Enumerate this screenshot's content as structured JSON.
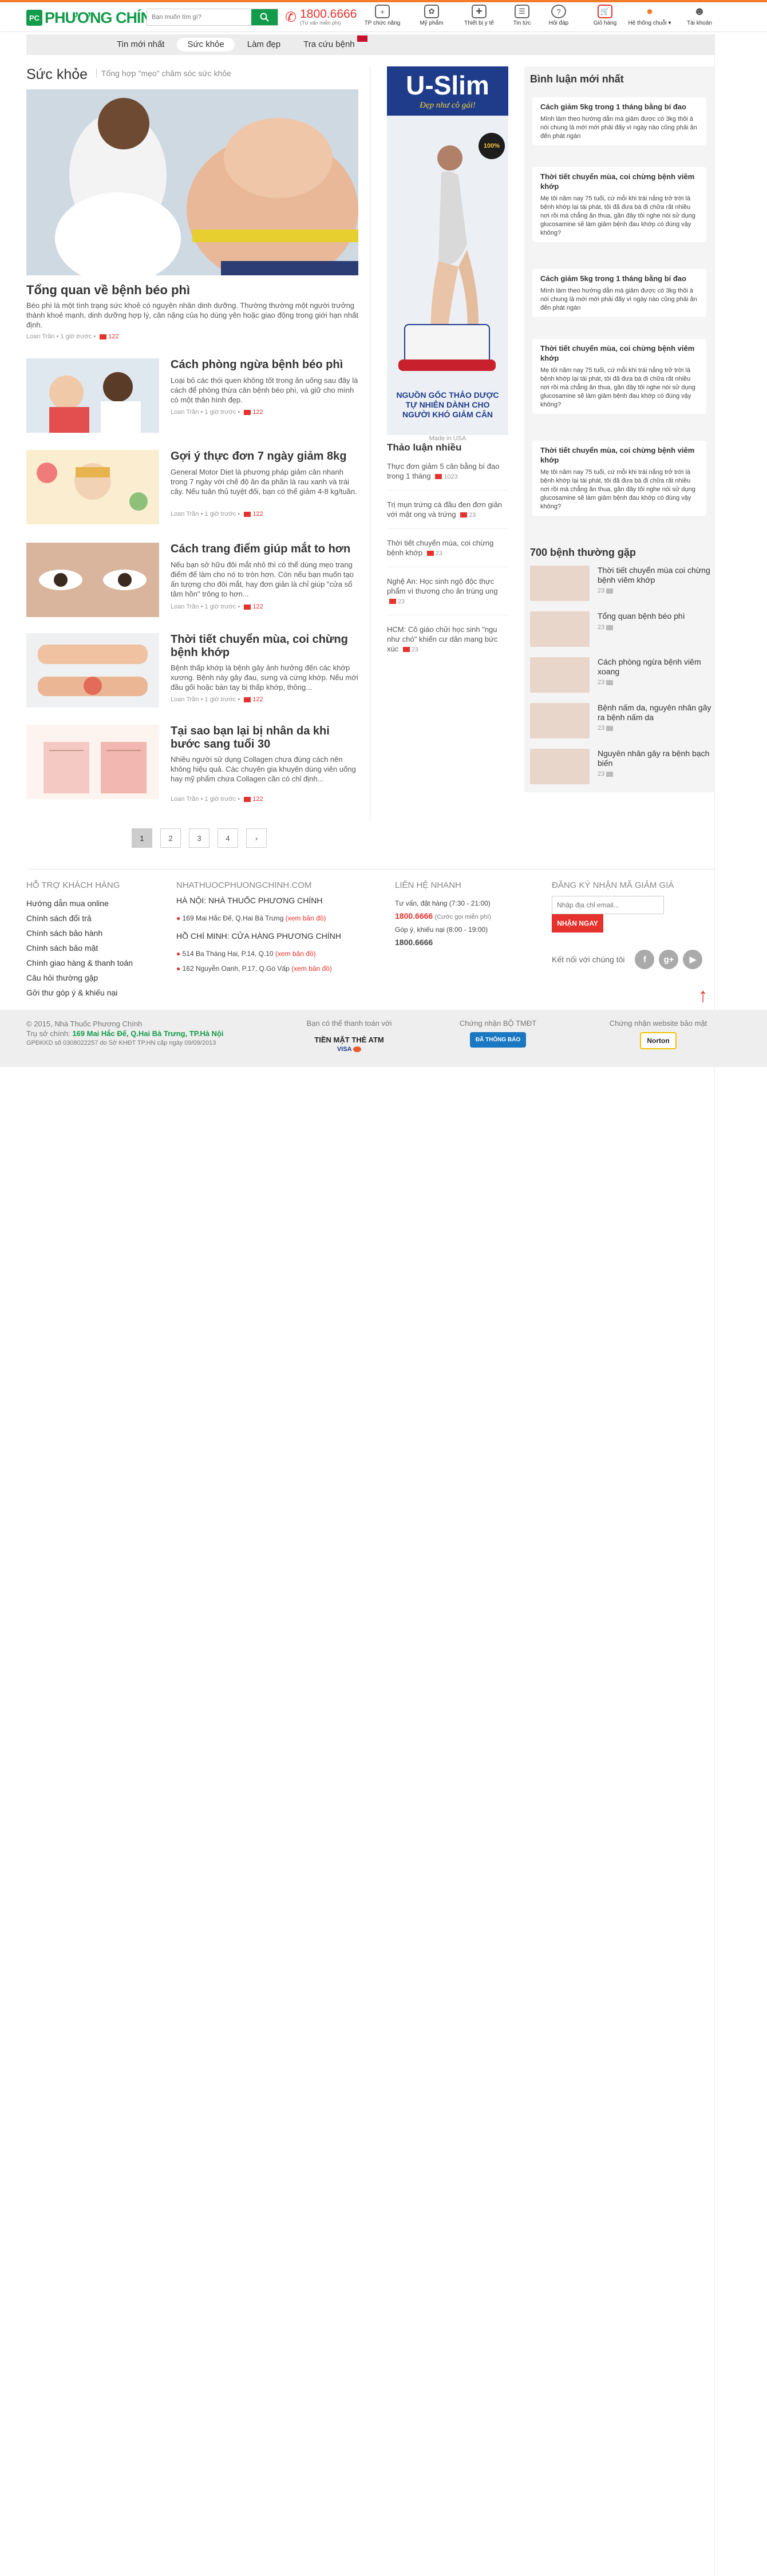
{
  "header": {
    "logo_mark": "PC",
    "logo_text": "PHƯƠNG CHÍNH",
    "search_placeholder": "Bạn muốn tìm gì?",
    "hotline_number": "1800.6666",
    "hotline_sub": "(Tư vấn miễn phí)",
    "nav": [
      {
        "label": "TP chức năng",
        "icon": "supplement-box-icon"
      },
      {
        "label": "Mỹ phẩm",
        "icon": "cosmetics-icon"
      },
      {
        "label": "Thiết bị y tế",
        "icon": "medical-kit-icon"
      },
      {
        "label": "Tin tức",
        "icon": "news-icon"
      },
      {
        "label": "Hỏi đáp",
        "icon": "question-icon"
      },
      {
        "label": "Giỏ hàng",
        "icon": "cart-icon"
      },
      {
        "label": "Hệ thống chuỗi",
        "icon": "location-pin-icon"
      },
      {
        "label": "Tài khoản",
        "icon": "user-icon"
      }
    ]
  },
  "menu": {
    "items": [
      "Tin mới nhất",
      "Sức khỏe",
      "Làm đẹp",
      "Tra cứu bệnh"
    ],
    "active_index": 1
  },
  "page": {
    "title": "Sức khỏe",
    "subtitle": "Tổng hợp \"mẹo\" chăm sóc sức khỏe"
  },
  "featured": {
    "title": "Tổng quan về bệnh béo phì",
    "desc": "Béo phì là một tình trạng sức khoẻ có nguyên nhân dinh dưỡng. Thường thường một người trưởng thành khoẻ mạnh, dinh dưỡng hợp lý, cân nặng của họ dùng yên hoặc giao động trong giới hạn nhất định.",
    "author": "Loan Trần",
    "time": "1 giờ trước",
    "comments": "122"
  },
  "articles": [
    {
      "title": "Cách phòng ngừa bệnh béo phì",
      "desc": "Loại bỏ các thói quen không tốt trong ăn uống sau đây là cách để phòng thừa cân bệnh béo phì, và giữ cho mình có một thân hình đẹp.",
      "author": "Loan Trần",
      "time": "1 giờ trước",
      "comments": "122"
    },
    {
      "title": "Gợi ý thực đơn 7 ngày giảm 8kg",
      "desc": "General Motor Diet là phương pháp giảm cân nhanh trong 7 ngày với chế độ ăn đa phần là rau xanh và trái cây. Nếu tuân thủ tuyệt đối, bạn có thể giảm 4-8 kg/tuần.",
      "author": "Loan Trần",
      "time": "1 giờ trước",
      "comments": "122"
    },
    {
      "title": "Cách trang điểm giúp mắt to hơn",
      "desc": "Nếu bạn sở hữu đôi mắt nhỏ thì có thể dùng mẹo trang điểm để làm cho nó to tròn hơn. Còn nếu bạn muốn tạo ấn tượng cho đôi mắt, hay đơn giản là chỉ giúp \"cửa sổ tâm hồn\" trông to hơn...",
      "author": "Loan Trần",
      "time": "1 giờ trước",
      "comments": "122"
    },
    {
      "title": "Thời tiết chuyển mùa, coi chừng bệnh khớp",
      "desc": "Bệnh thấp khớp là bệnh gây ảnh hưởng đến các khớp xương. Bệnh này gây đau, sưng và cứng khớp. Nếu mới đầu gối hoặc bàn tay bị thấp khớp, thông...",
      "author": "Loan Trần",
      "time": "1 giờ trước",
      "comments": "122"
    },
    {
      "title": "Tại sao bạn lại bị nhân da khi bước sang tuổi 30",
      "desc": "Nhiều người sử dụng Collagen chưa đúng cách nên không hiệu quả. Các chuyên gia khuyên dùng viên uống hay mỹ phẩm chứa Collagen cần có chỉ định...",
      "author": "Loan Trần",
      "time": "1 giờ trước",
      "comments": "122"
    }
  ],
  "pagination": [
    "1",
    "2",
    "3",
    "4",
    "›"
  ],
  "ad": {
    "brand": "U-Slim",
    "tagline": "Đẹp như cô gái!",
    "badge": "100%",
    "headline": "NGUỒN GỐC THẢO DƯỢC TỰ NHIÊN DÀNH CHO NGƯỜI KHÓ GIẢM CÂN",
    "caption": "Made in USA"
  },
  "discussion": {
    "title": "Thảo luận nhiều",
    "items": [
      {
        "text": "Thực đơn giảm 5 cân bằng bí đao trong 1 tháng",
        "count": "1023"
      },
      {
        "text": "Trị mụn trứng cá đầu đen đơn giản với mật ong và trứng",
        "count": "23"
      },
      {
        "text": "Thời tiết chuyển mùa, coi chừng bệnh khớp",
        "count": "23"
      },
      {
        "text": "Nghệ An: Học sinh ngộ độc thực phẩm vì thương cho ăn trùng ung",
        "count": "23"
      },
      {
        "text": "HCM: Cô giáo chửi học sinh \"ngu như chó\" khiến cư dân mạng bức xúc",
        "count": "23"
      }
    ]
  },
  "comments_latest": {
    "title": "Bình luận mới nhất",
    "items": [
      {
        "title": "Cách giảm 5kg trong 1 tháng bằng bí đao",
        "text": "Mình làm theo hướng dẫn mà giảm được có 3kg thôi à nói chung là mới mới phải đấy vì ngày nào cũng phải ăn đến phát ngán"
      },
      {
        "title": "Thời tiết chuyển mùa, coi chừng bệnh viêm khớp",
        "text": "Mẹ tôi năm nay 75 tuổi, cứ mỗi khi trái nắng trở trời là bệnh khớp lại tái phát, tôi đã đưa bà đi chữa rất nhiều nơi rồi mà chẳng ăn thua, gần đây tôi nghe nói sử dụng glucosamine sẽ làm giảm bệnh đau khớp có đúng vậy không?"
      },
      {
        "title": "Cách giảm 5kg trong 1 tháng bằng bí đao",
        "text": "Mình làm theo hướng dẫn mà giảm được có 3kg thôi à nói chung là mới mới phải đấy vì ngày nào cũng phải ăn đến phát ngán"
      },
      {
        "title": "Thời tiết chuyển mùa, coi chừng bệnh viêm khớp",
        "text": "Mẹ tôi năm nay 75 tuổi, cứ mỗi khi trái nắng trở trời là bệnh khớp lại tái phát, tôi đã đưa bà đi chữa rất nhiều nơi rồi mà chẳng ăn thua, gần đây tôi nghe nói sử dụng glucosamine sẽ làm giảm bệnh đau khớp có đúng vậy không?"
      },
      {
        "title": "Thời tiết chuyển mùa, coi chừng bệnh viêm khớp",
        "text": "Mẹ tôi năm nay 75 tuổi, cứ mỗi khi trái nắng trở trời là bệnh khớp lại tái phát, tôi đã đưa bà đi chữa rất nhiều nơi rồi mà chẳng ăn thua, gần đây tôi nghe nói sử dụng glucosamine sẽ làm giảm bệnh đau khớp có đúng vậy không?"
      }
    ]
  },
  "common_diseases": {
    "title": "700 bệnh thường gặp",
    "items": [
      {
        "title": "Thời tiết chuyển mùa coi chừng bệnh viêm khớp",
        "count": "23"
      },
      {
        "title": "Tổng quan bệnh béo phì",
        "count": "23"
      },
      {
        "title": "Cách phòng ngừa bệnh viêm xoang",
        "count": "23"
      },
      {
        "title": "Bệnh nấm da, nguyên nhân gây ra bệnh nấm da",
        "count": "23"
      },
      {
        "title": "Nguyên nhân gây ra bệnh bạch biến",
        "count": "23"
      }
    ]
  },
  "footer": {
    "support_title": "HỖ TRỢ KHÁCH HÀNG",
    "support_links": [
      "Hướng dẫn mua online",
      "Chính sách đổi trả",
      "Chính sách bảo hành",
      "Chính sách bảo mật",
      "Chính giao hàng & thanh toán",
      "Câu hỏi thường gặp",
      "Gởi thư góp ý & khiếu nại"
    ],
    "stores_title": "NHATHUOCPHUONGCHINH.COM",
    "hn_title": "HÀ NỘI: NHÀ THUỐC PHƯƠNG CHÍNH",
    "hn_addr": "169 Mai Hắc Đế, Q.Hai Bà Trưng",
    "hn_map": "(xem bản đồ)",
    "hcm_title": "HỒ CHÍ MINH: CỬA HÀNG PHƯƠNG CHÍNH",
    "hcm_addr1": "514 Ba Tháng Hai, P.14, Q.10",
    "hcm_addr2": "162 Nguyễn Oanh, P.17, Q.Gò Vấp",
    "hcm_map1": "(xem bản đồ)",
    "hcm_map2": "(xem bản đồ)",
    "contact_title": "LIÊN HỆ NHANH",
    "contact_advice": "Tư vấn, đặt hàng (7:30 - 21:00)",
    "contact_advice_num": "1800.6666",
    "contact_advice_note": "(Cước gọi miễn phí)",
    "contact_complaint": "Góp ý, khiếu nại (8:00 - 19:00)",
    "contact_complaint_num": "1800.6666",
    "newsletter_title": "ĐĂNG KÝ NHẬN MÃ GIẢM GIÁ",
    "newsletter_placeholder": "Nhập địa chỉ email...",
    "newsletter_button": "NHẬN NGAY",
    "social_label": "Kết nối với chúng tôi",
    "social": [
      "f",
      "g+",
      "▶"
    ]
  },
  "bottom": {
    "copyright": "© 2015, Nhà Thuốc Phương Chính",
    "hq_label": "Trụ sở chính:",
    "hq_addr": "169 Mai Hắc Đế, Q.Hai Bà Trưng, TP.Hà Nội",
    "license": "GPĐKKD số 0308022257 do Sở KHĐT TP.HN cấp ngày 09/09/2013",
    "pay_title": "Bạn có thể thanh toán với",
    "pay_methods": "TIỀN MẶT  THẺ ATM",
    "pay_cards": "VISA",
    "moit_title": "Chứng nhận BỘ TMĐT",
    "moit_badge": "ĐÃ THÔNG BÁO",
    "secure_title": "Chứng nhận website bảo mật",
    "secure_badge": "Norton"
  },
  "colors": {
    "brand_green": "#129b4a",
    "accent_red": "#e5322d",
    "accent_orange": "#f47c2c"
  }
}
